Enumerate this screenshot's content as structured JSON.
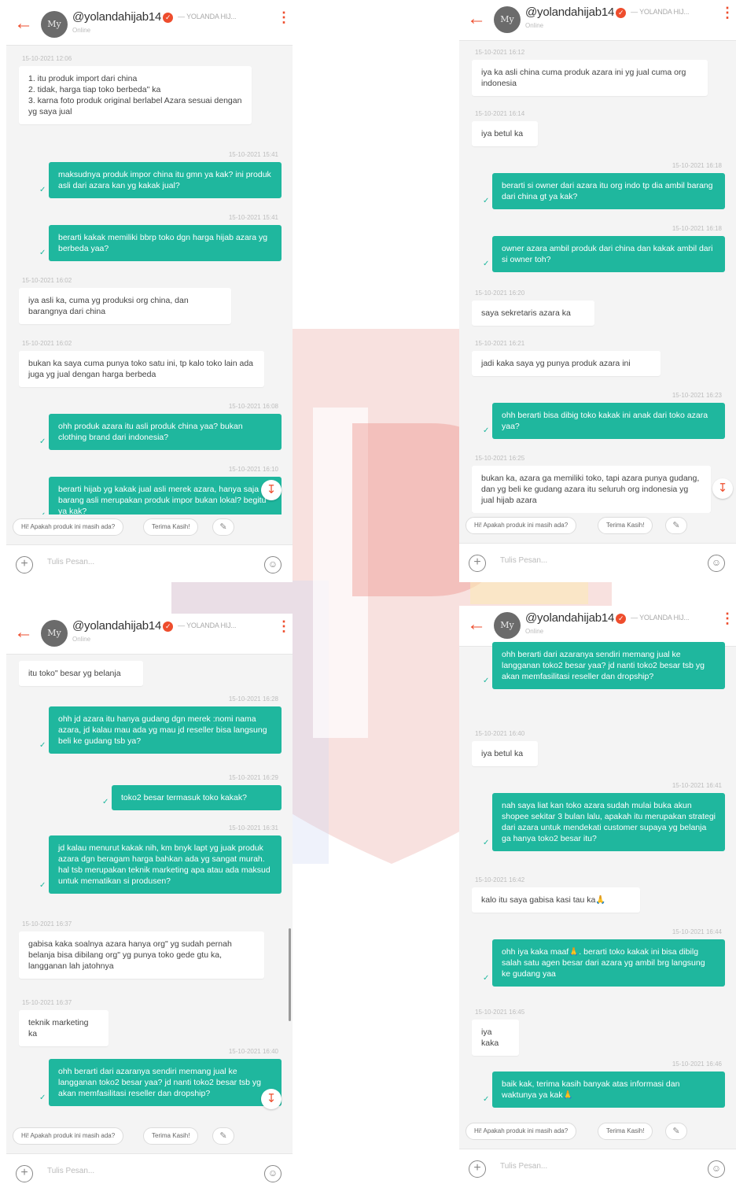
{
  "colors": {
    "accent": "#ee4d2d",
    "bubble_out": "#1fb79e",
    "bubble_in": "#ffffff",
    "bg": "#f4f4f4"
  },
  "header": {
    "username": "@yolandahijab14",
    "shop": "— YOLANDA HIJ...",
    "status": "Online",
    "avatar": "My"
  },
  "chips": {
    "question": "Hi! Apakah produk ini masih ada?",
    "thanks": "Terima Kasih!"
  },
  "input_placeholder": "Tulis Pesan...",
  "panel1": {
    "messages": [
      {
        "dir": "in",
        "time": "15-10-2021 12:06",
        "text": "1. itu produk import dari china\n2. tidak, harga tiap toko berbeda\" ka\n3. karna foto produk original berlabel Azara sesuai dengan yg saya jual"
      },
      {
        "dir": "out",
        "time": "15-10-2021 15:41",
        "text": "maksudnya produk impor china itu gmn ya kak? ini produk asli dari azara kan yg kakak jual?"
      },
      {
        "dir": "out",
        "time": "15-10-2021 15:41",
        "text": "berarti kakak memiliki bbrp toko dgn harga hijab azara yg berbeda yaa?"
      },
      {
        "dir": "in",
        "time": "15-10-2021 16:02",
        "text": "iya asli ka, cuma yg produksi org china, dan barangnya dari china"
      },
      {
        "dir": "in",
        "time": "15-10-2021 16:02",
        "text": "bukan ka saya cuma punya toko satu ini, tp kalo toko lain ada juga yg jual dengan harga berbeda"
      },
      {
        "dir": "out",
        "time": "15-10-2021 16:08",
        "text": "ohh produk azara itu asli produk china yaa? bukan clothing brand dari indonesia?"
      },
      {
        "dir": "out",
        "time": "15-10-2021 16:10",
        "text": "berarti hijab yg kakak jual asli merek azara, hanya saja si barang asli merupakan produk impor bukan lokal? begitu ya kak?"
      }
    ]
  },
  "panel2": {
    "messages": [
      {
        "dir": "in",
        "time": "15-10-2021 16:12",
        "text": "iya ka asli china cuma produk azara ini yg jual cuma org indonesia"
      },
      {
        "dir": "in",
        "time": "15-10-2021 16:14",
        "text": "iya betul ka"
      },
      {
        "dir": "out",
        "time": "15-10-2021 16:18",
        "text": "berarti si owner dari azara itu org indo tp dia ambil barang dari china gt ya kak?"
      },
      {
        "dir": "out",
        "time": "15-10-2021 16:18",
        "text": "owner azara ambil produk dari china dan kakak ambil dari si owner toh?"
      },
      {
        "dir": "in",
        "time": "15-10-2021 16:20",
        "text": "saya sekretaris azara ka"
      },
      {
        "dir": "in",
        "time": "15-10-2021 16:21",
        "text": "jadi kaka saya yg punya produk azara ini"
      },
      {
        "dir": "out",
        "time": "15-10-2021 16:23",
        "text": "ohh berarti bisa dibig toko kakak ini anak dari toko azara yaa?"
      },
      {
        "dir": "in",
        "time": "15-10-2021 16:25",
        "text": "bukan ka, azara ga memiliki toko, tapi azara punya gudang, dan yg beli ke gudang azara itu seluruh org indonesia yg jual hijab azara"
      }
    ]
  },
  "panel3": {
    "messages": [
      {
        "dir": "in",
        "time": "",
        "text": "itu toko\" besar yg belanja"
      },
      {
        "dir": "out",
        "time": "15-10-2021 16:28",
        "text": "ohh jd azara itu hanya gudang dgn merek :nomi nama azara, jd kalau mau ada yg mau jd reseller bisa langsung beli ke gudang tsb ya?"
      },
      {
        "dir": "out",
        "time": "15-10-2021 16:29",
        "text": "toko2 besar termasuk toko kakak?"
      },
      {
        "dir": "out",
        "time": "15-10-2021 16:31",
        "text": "jd kalau menurut kakak nih, km bnyk lapt yg juak produk azara dgn beragam harga bahkan ada yg sangat murah. hal tsb merupakan teknik marketing apa atau ada maksud untuk mematikan si produsen?"
      },
      {
        "dir": "in",
        "time": "15-10-2021 16:37",
        "text": "gabisa kaka soalnya azara hanya org\" yg sudah pernah belanja bisa dibilang org\" yg punya toko gede gtu ka, langganan lah jatohnya"
      },
      {
        "dir": "in",
        "time": "15-10-2021 16:37",
        "text": "teknik marketing ka"
      },
      {
        "dir": "out",
        "time": "15-10-2021 16:40",
        "text": "ohh berarti dari azaranya sendiri memang jual ke langganan toko2 besar yaa? jd nanti toko2 besar tsb yg akan memfasilitasi reseller dan dropship?"
      }
    ]
  },
  "panel4": {
    "messages": [
      {
        "dir": "out",
        "time": "",
        "text": "ohh berarti dari azaranya sendiri memang jual ke langganan toko2 besar yaa? jd nanti toko2 besar tsb yg akan memfasilitasi reseller dan dropship?"
      },
      {
        "dir": "in",
        "time": "15-10-2021 16:40",
        "text": "iya betul ka"
      },
      {
        "dir": "out",
        "time": "15-10-2021 16:41",
        "text": "nah saya liat kan toko azara sudah mulai buka akun shopee sekitar 3 bulan lalu, apakah itu merupakan strategi dari azara untuk mendekati customer supaya yg belanja ga hanya toko2 besar itu?"
      },
      {
        "dir": "in",
        "time": "15-10-2021 16:42",
        "text": "kalo itu saya gabisa kasi tau ka🙏"
      },
      {
        "dir": "out",
        "time": "15-10-2021 16:44",
        "text": "ohh iya kaka maaf🙏. berarti toko kakak ini bisa dibilg salah satu agen besar dari azara yg ambil brg langsung ke gudang yaa"
      },
      {
        "dir": "in",
        "time": "15-10-2021 16:45",
        "text": "iya kaka"
      },
      {
        "dir": "out",
        "time": "15-10-2021 16:46",
        "text": "baik kak, terima kasih banyak atas informasi dan waktunya ya kak🙏"
      }
    ]
  }
}
